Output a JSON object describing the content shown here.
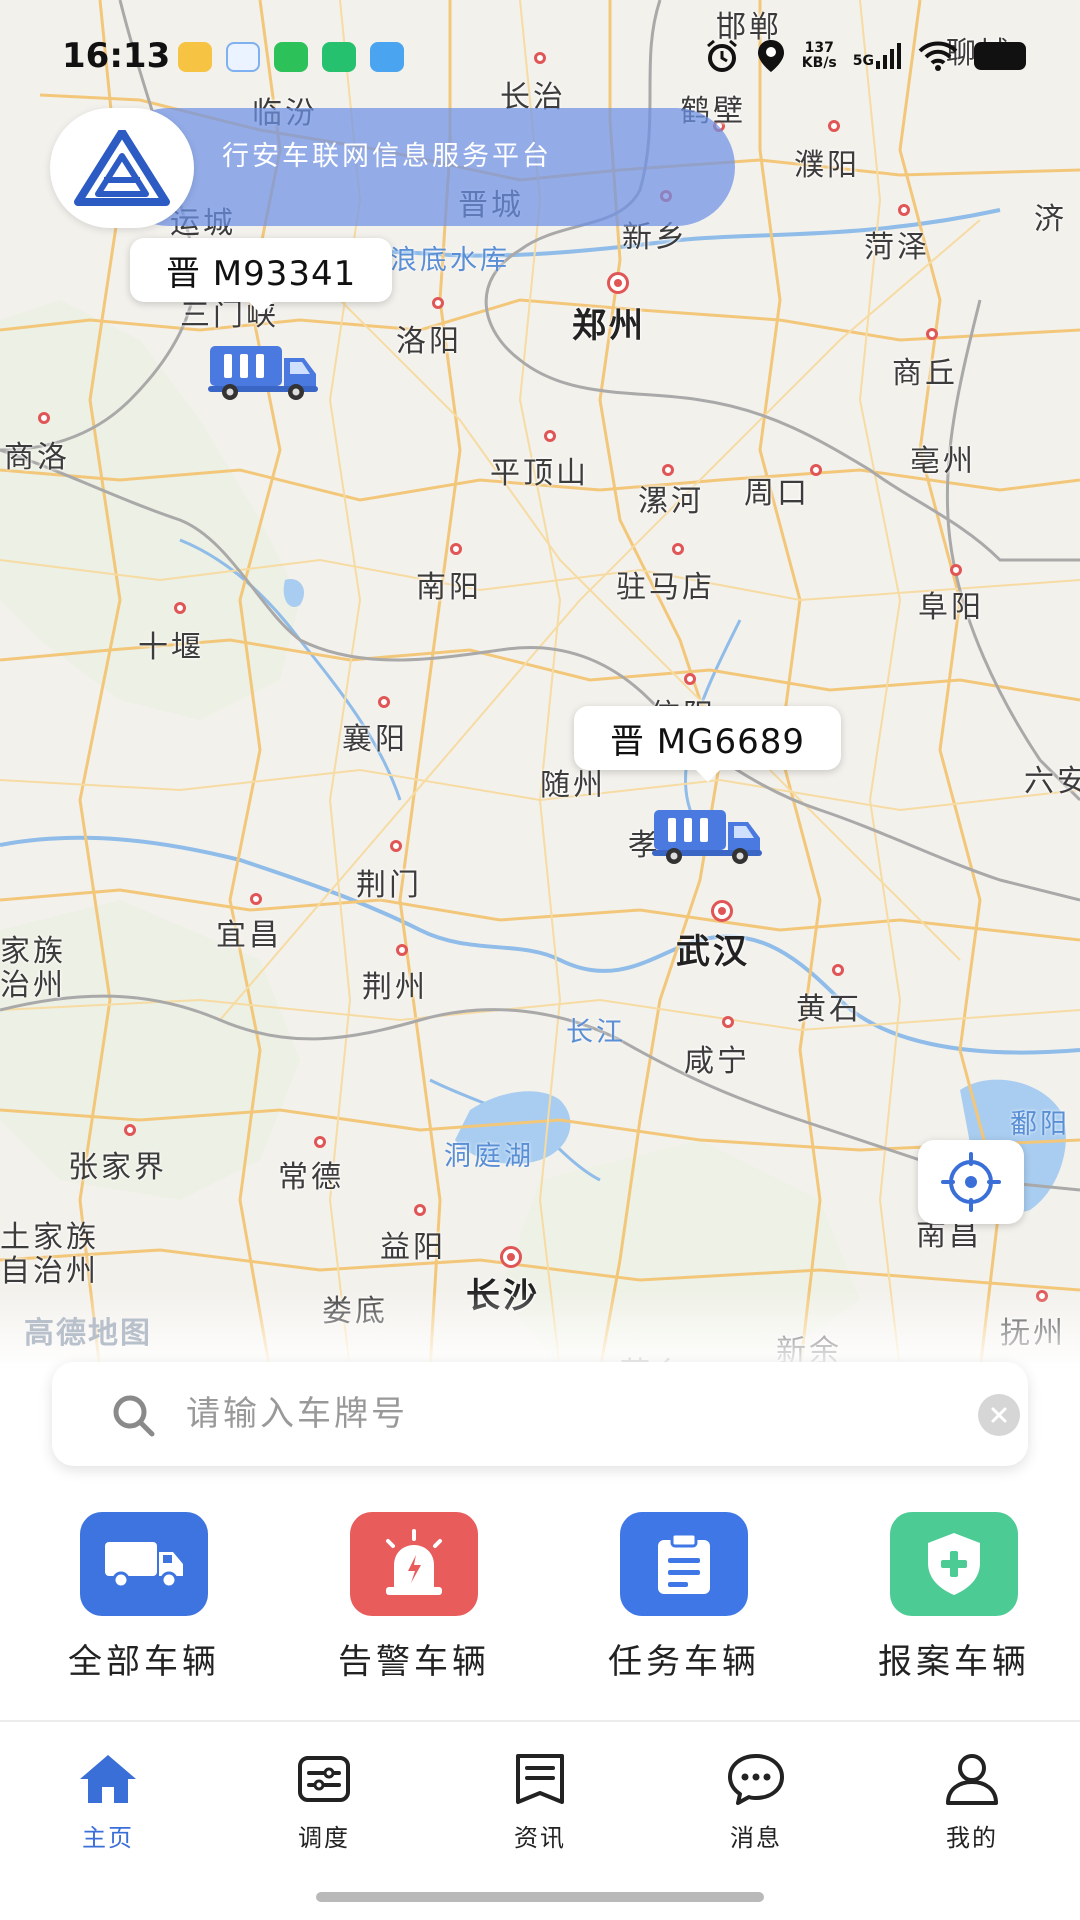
{
  "status_bar": {
    "time": "16:13",
    "net_speed_value": "137",
    "net_speed_unit": "KB/s",
    "network": "5G",
    "app_icons": [
      "weibo-icon",
      "chat-bubble-icon",
      "wechat-icon",
      "shop-icon",
      "send-icon"
    ],
    "right_icons": [
      "alarm-icon",
      "location-icon",
      "signal-icon",
      "wifi-icon",
      "battery-icon"
    ]
  },
  "banner": {
    "title": "行安车联网信息服务平台"
  },
  "map": {
    "cities": [
      {
        "name": "邯郸"
      },
      {
        "name": "聊城"
      },
      {
        "name": "临汾"
      },
      {
        "name": "长治"
      },
      {
        "name": "鹤壁"
      },
      {
        "name": "濮阳"
      },
      {
        "name": "晋城"
      },
      {
        "name": "新乡"
      },
      {
        "name": "运城"
      },
      {
        "name": "菏泽"
      },
      {
        "name": "济"
      },
      {
        "name": "郑州"
      },
      {
        "name": "三门峡"
      },
      {
        "name": "洛阳"
      },
      {
        "name": "商丘"
      },
      {
        "name": "商洛"
      },
      {
        "name": "平顶山"
      },
      {
        "name": "漯河"
      },
      {
        "name": "周口"
      },
      {
        "name": "亳州"
      },
      {
        "name": "南阳"
      },
      {
        "name": "驻马店"
      },
      {
        "name": "阜阳"
      },
      {
        "name": "十堰"
      },
      {
        "name": "信阳"
      },
      {
        "name": "襄阳"
      },
      {
        "name": "随州"
      },
      {
        "name": "六安"
      },
      {
        "name": "孝"
      },
      {
        "name": "荆门"
      },
      {
        "name": "宜昌"
      },
      {
        "name": "武汉"
      },
      {
        "name": "家族"
      },
      {
        "name": "治州"
      },
      {
        "name": "荆州"
      },
      {
        "name": "黄石"
      },
      {
        "name": "咸宁"
      },
      {
        "name": "张家界"
      },
      {
        "name": "常德"
      },
      {
        "name": "土家族"
      },
      {
        "name": "自治州"
      },
      {
        "name": "益阳"
      },
      {
        "name": "长沙"
      },
      {
        "name": "娄底"
      },
      {
        "name": "南昌"
      },
      {
        "name": "新余"
      },
      {
        "name": "抚州"
      },
      {
        "name": "萍乡"
      }
    ],
    "water_labels": [
      {
        "name": "小浪底水库"
      },
      {
        "name": "长江"
      },
      {
        "name": "洞庭湖"
      },
      {
        "name": "鄱阳"
      }
    ],
    "provider_logo": "高德地图"
  },
  "vehicles": [
    {
      "plate": "晋 M93341",
      "icon": "truck-icon"
    },
    {
      "plate": "晋 MG6689",
      "icon": "truck-icon"
    }
  ],
  "search": {
    "placeholder": "请输入车牌号",
    "value": ""
  },
  "actions": [
    {
      "label": "全部车辆",
      "icon": "truck-icon",
      "color": "#3d74e0"
    },
    {
      "label": "告警车辆",
      "icon": "alarm-light-icon",
      "color": "#e85c5c"
    },
    {
      "label": "任务车辆",
      "icon": "clipboard-icon",
      "color": "#3f78e6"
    },
    {
      "label": "报案车辆",
      "icon": "shield-plus-icon",
      "color": "#4ccb95"
    }
  ],
  "tabs": [
    {
      "label": "主页",
      "icon": "home-icon",
      "active": true
    },
    {
      "label": "调度",
      "icon": "sliders-icon",
      "active": false
    },
    {
      "label": "资讯",
      "icon": "news-icon",
      "active": false
    },
    {
      "label": "消息",
      "icon": "message-icon",
      "active": false
    },
    {
      "label": "我的",
      "icon": "user-icon",
      "active": false
    }
  ],
  "colors": {
    "accent": "#3b6fd8",
    "banner": "#6e91e6",
    "road": "#f3c77a",
    "boundary": "#a9a9a9",
    "river": "#8fbce8"
  }
}
